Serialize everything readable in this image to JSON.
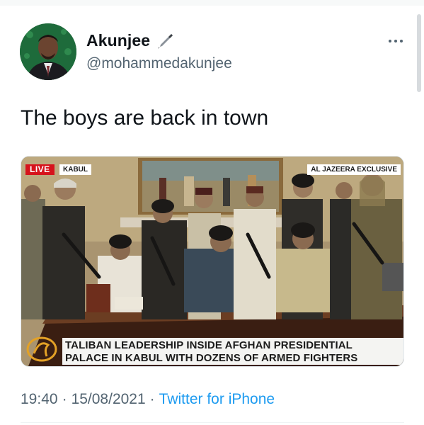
{
  "tweet": {
    "author": {
      "display_name": "Akunjee",
      "handle": "@mohammedakunjee",
      "avatar_icon": "profile-photo",
      "badge_icon": "fountain-pen-icon"
    },
    "text": "The boys are back in town",
    "more_icon": "ellipsis-icon",
    "media": {
      "live_label": "LIVE",
      "location_label": "KABUL",
      "exclusive_label": "AL JAZEERA EXCLUSIVE",
      "headline_line1": "TALIBAN LEADERSHIP INSIDE AFGHAN PRESIDENTIAL",
      "headline_line2": "PALACE IN KABUL WITH DOZENS OF ARMED FIGHTERS",
      "logo_icon": "al-jazeera-logo-icon"
    },
    "time": "19:40",
    "date": "15/08/2021",
    "separator": "·",
    "source": "Twitter for iPhone"
  },
  "colors": {
    "text_primary": "#0f1419",
    "text_secondary": "#536471",
    "link": "#1d9bf0",
    "live_red": "#d6131c"
  }
}
